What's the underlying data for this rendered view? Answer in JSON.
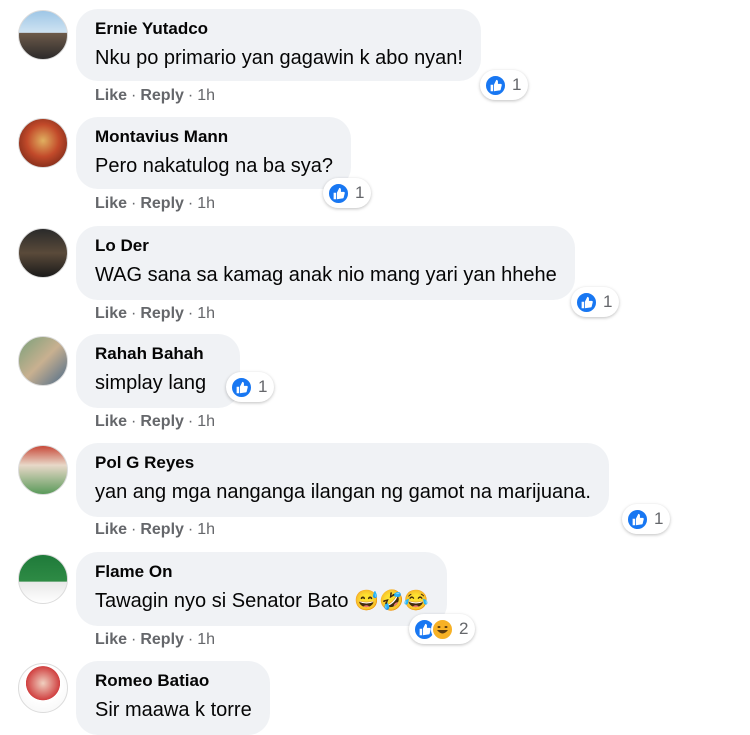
{
  "actions": {
    "like": "Like",
    "reply": "Reply",
    "separator": "·"
  },
  "comments": [
    {
      "author": "Ernie Yutadco",
      "text": "Nku po primario yan gagawin k abo nyan!",
      "reaction_count": "1",
      "time": "1h"
    },
    {
      "author": "Montavius Mann",
      "text": "Pero nakatulog na ba sya?",
      "reaction_count": "1",
      "time": "1h"
    },
    {
      "author": "Lo Der",
      "text": "WAG sana sa kamag anak nio mang yari yan hhehe",
      "reaction_count": "1",
      "time": "1h"
    },
    {
      "author": "Rahah Bahah",
      "text": "simplay lang",
      "reaction_count": "1",
      "time": "1h"
    },
    {
      "author": "Pol G Reyes",
      "text": "yan ang mga nanganga ilangan ng gamot na marijuana.",
      "reaction_count": "1",
      "time": "1h"
    },
    {
      "author": "Flame On",
      "text": "Tawagin nyo si Senator Bato 😅🤣😂",
      "reaction_count": "2",
      "time": "1h"
    },
    {
      "author": "Romeo Batiao",
      "text": "Sir maawa k torre"
    }
  ],
  "icons": {
    "like": "like-reaction-icon",
    "haha": "haha-reaction-icon"
  },
  "colors": {
    "like_blue": "#1877f2",
    "bubble_bg": "#f0f2f5",
    "meta_gray": "#65676b"
  }
}
